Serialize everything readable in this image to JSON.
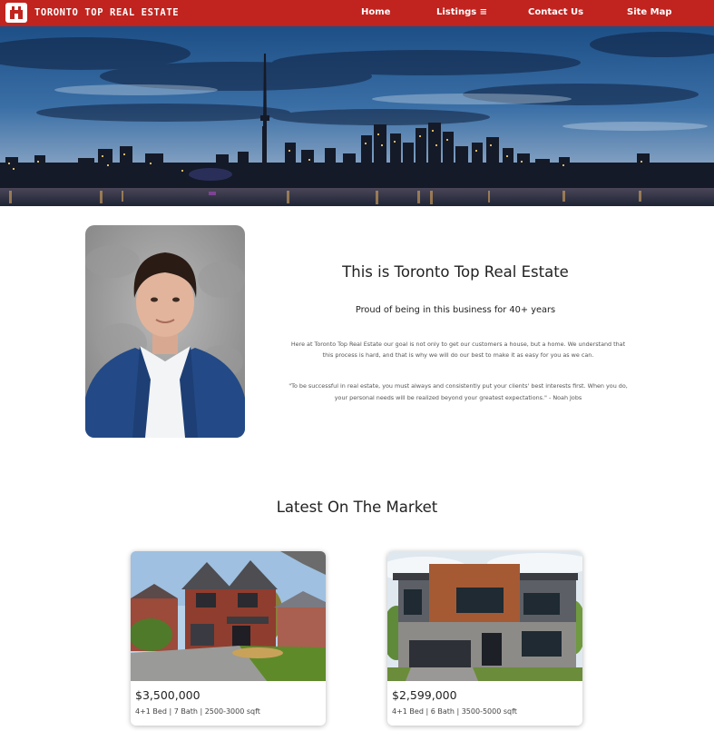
{
  "nav": {
    "brand": "TORONTO TOP REAL ESTATE",
    "brand_icon": "house-logo-icon",
    "links": [
      "Home",
      "Listings ≡",
      "Contact Us",
      "Site Map"
    ],
    "accent_color": "#c1231e"
  },
  "hero": {
    "image": "toronto-skyline-night-photo"
  },
  "about": {
    "portrait": "agent-portrait-photo",
    "title": "This is Toronto Top Real Estate",
    "subtitle": "Proud of being in this business for 40+ years",
    "body": "Here at Toronto Top Real Estate our goal is not only to get our customers a house, but a home. We understand that this process is hard, and that is why we will do our best to make it as easy for you as we can.",
    "quote": "\"To be successful in real estate, you must always and consistently put your clients' best interests first. When you do, your personal needs will be realized beyond your greatest expectations.\" - Noah Jobs"
  },
  "market": {
    "title": "Latest On The Market",
    "listings": [
      {
        "price": "$3,500,000",
        "meta": "4+1 Bed  |  7 Bath  |  2500-3000 sqft",
        "image": "brick-house-photo"
      },
      {
        "price": "$2,599,000",
        "meta": "4+1 Bed  |  6 Bath  |  3500-5000 sqft",
        "image": "modern-house-photo"
      }
    ]
  }
}
